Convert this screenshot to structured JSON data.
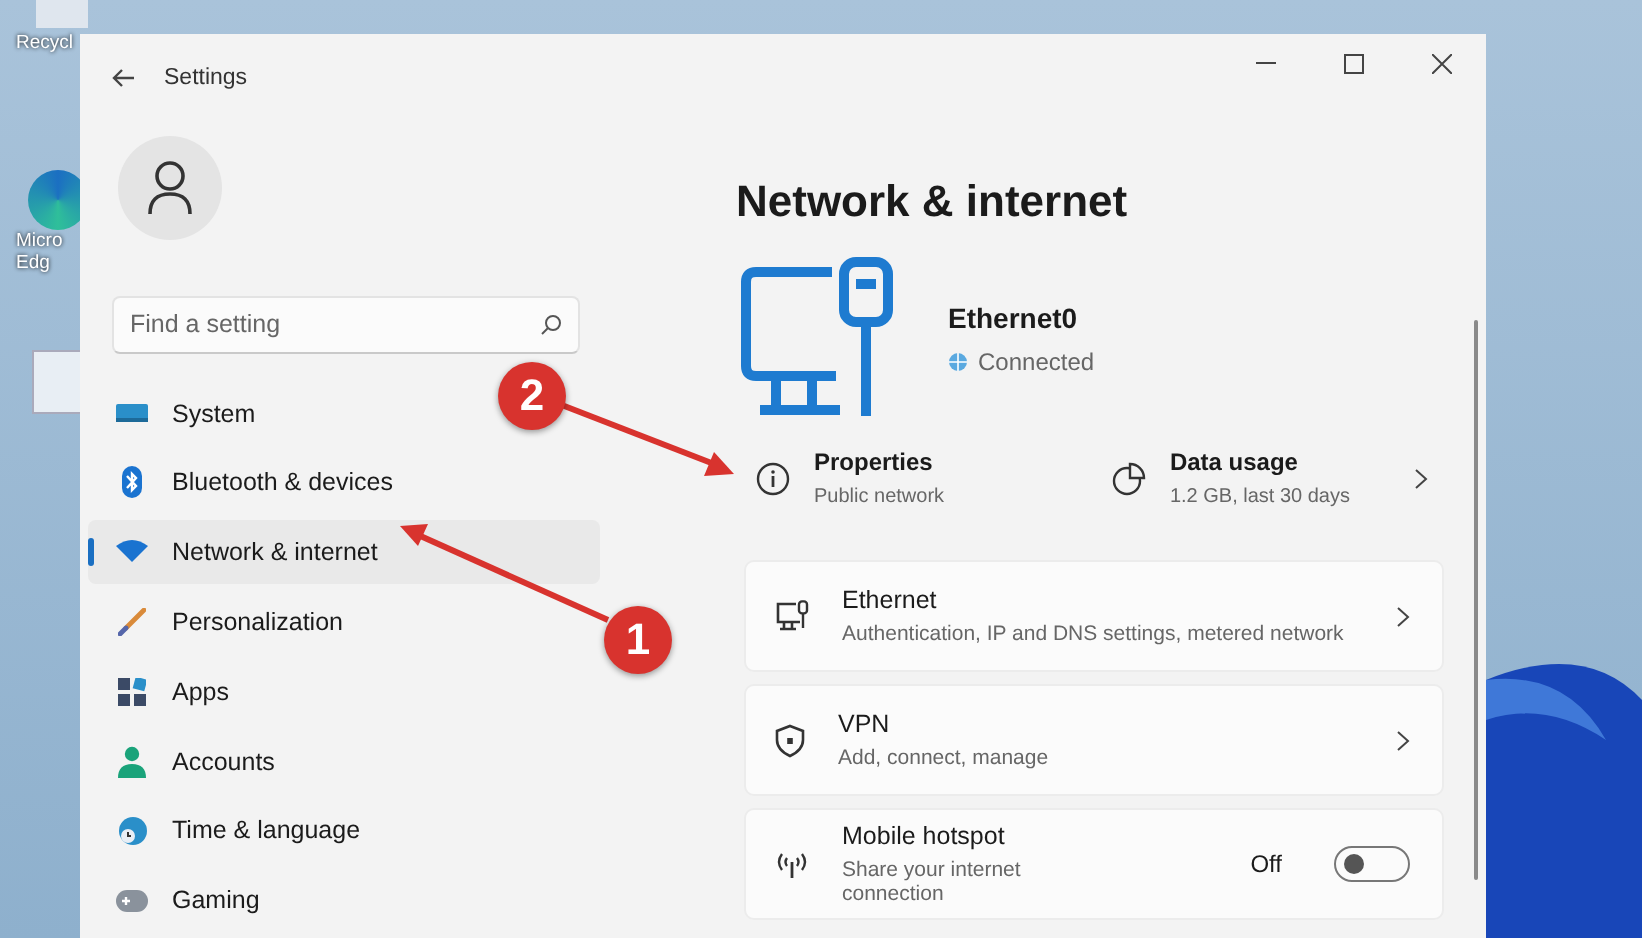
{
  "desktop": {
    "icons": [
      {
        "kind": "bin",
        "lines": [
          "Recycl"
        ]
      },
      {
        "kind": "browser",
        "lines": [
          "Micro",
          "Edg"
        ]
      },
      {
        "kind": "document"
      }
    ]
  },
  "window": {
    "title": "Settings"
  },
  "search": {
    "placeholder": "Find a setting"
  },
  "sidebar": {
    "items": [
      {
        "label": "System",
        "selected": false
      },
      {
        "label": "Bluetooth & devices",
        "selected": false
      },
      {
        "label": "Network & internet",
        "selected": true
      },
      {
        "label": "Personalization",
        "selected": false
      },
      {
        "label": "Apps",
        "selected": false
      },
      {
        "label": "Accounts",
        "selected": false
      },
      {
        "label": "Time & language",
        "selected": false
      },
      {
        "label": "Gaming",
        "selected": false
      }
    ]
  },
  "page": {
    "title": "Network & internet",
    "adapter": {
      "name": "Ethernet0",
      "status": "Connected"
    },
    "properties": {
      "title": "Properties",
      "subtitle": "Public network"
    },
    "data_usage": {
      "title": "Data usage",
      "subtitle": "1.2 GB, last 30 days"
    },
    "cards": [
      {
        "kind": "link",
        "title": "Ethernet",
        "subtitle": "Authentication, IP and DNS settings, metered network"
      },
      {
        "kind": "link",
        "title": "VPN",
        "subtitle": "Add, connect, manage"
      },
      {
        "kind": "toggle",
        "title": "Mobile hotspot",
        "subtitle": "Share your internet connection",
        "state": "Off",
        "on": false
      }
    ]
  },
  "annotations": [
    {
      "label": "1"
    },
    {
      "label": "2"
    }
  ]
}
